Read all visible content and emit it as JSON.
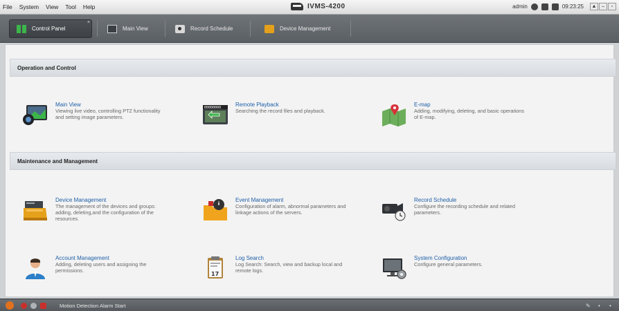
{
  "menubar": {
    "items": [
      "File",
      "System",
      "View",
      "Tool",
      "Help"
    ],
    "app_title": "IVMS-4200",
    "user": "admin",
    "time": "09:23:25",
    "window_buttons": [
      "▲",
      "–",
      "▫"
    ]
  },
  "tabs": [
    {
      "label": "Control Panel",
      "icon": "control-panel-icon",
      "active": true
    },
    {
      "label": "Main View",
      "icon": "main-view-icon",
      "active": false
    },
    {
      "label": "Record Schedule",
      "icon": "record-schedule-icon",
      "active": false
    },
    {
      "label": "Device Management",
      "icon": "device-management-icon",
      "active": false
    }
  ],
  "sections": [
    {
      "title": "Operation and Control",
      "items": [
        {
          "title": "Main View",
          "desc": "Viewing live video, controlling PTZ functionality and setting image parameters.",
          "icon": "main-view-monitor-icon"
        },
        {
          "title": "Remote Playback",
          "desc": "Searching the record files and playback.",
          "icon": "remote-playback-icon"
        },
        {
          "title": "E-map",
          "desc": "Adding, modifying, deleting, and basic operations of E-map.",
          "icon": "e-map-icon"
        }
      ]
    },
    {
      "title": "Maintenance and Management",
      "items": [
        {
          "title": "Device Management",
          "desc": "The management of the devices and groups: adding, deleting,and the configuration of the resources.",
          "icon": "device-management-icon"
        },
        {
          "title": "Event Management",
          "desc": "Configuration of alarm, abnormal parameters and linkage actions of the servers.",
          "icon": "event-management-icon"
        },
        {
          "title": "Record Schedule",
          "desc": "Configure the recording schedule and related parameters.",
          "icon": "record-schedule-icon"
        },
        {
          "title": "Account Management",
          "desc": "Adding, deleting users and assigning the permissions.",
          "icon": "account-management-icon"
        },
        {
          "title": "Log Search",
          "desc": "Log Search: Search, view and backup local and remote logs.",
          "icon": "log-search-icon"
        },
        {
          "title": "System Configuration",
          "desc": "Configure general parameters.",
          "icon": "system-configuration-icon"
        }
      ]
    }
  ],
  "statusbar": {
    "alarm_text": "Motion Detection Alarm Start"
  },
  "colors": {
    "link": "#1d5ea8",
    "tabbar": "#5f6468",
    "accent_green": "#3cb54a"
  }
}
